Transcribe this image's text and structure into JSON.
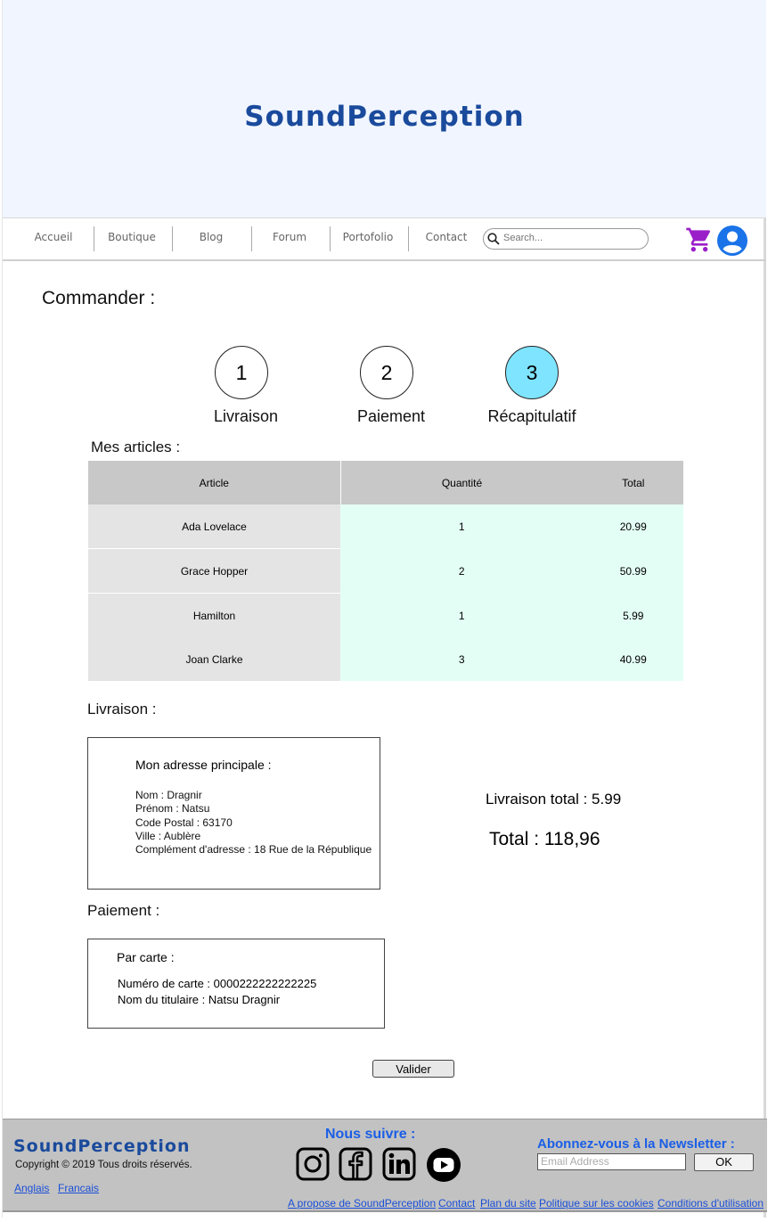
{
  "brand": "SoundPerception",
  "nav": {
    "items": [
      "Accueil",
      "Boutique",
      "Blog",
      "Forum",
      "Portofolio",
      "Contact"
    ],
    "search_placeholder": "Search..."
  },
  "colors": {
    "brand_blue": "#1a4a9c",
    "hero_bg": "#f0f5ff",
    "cart_purple": "#9b1fc9",
    "user_blue": "#1a73e8",
    "active_step": "#7fe4ff"
  },
  "page_title": "Commander :",
  "steps": [
    {
      "number": "1",
      "label": "Livraison",
      "active": false
    },
    {
      "number": "2",
      "label": "Paiement",
      "active": false
    },
    {
      "number": "3",
      "label": "Récapitulatif",
      "active": true
    }
  ],
  "articles": {
    "title": "Mes articles :",
    "columns": [
      "Article",
      "Quantité",
      "Total"
    ],
    "rows": [
      [
        "Ada Lovelace",
        "1",
        "20.99"
      ],
      [
        "Grace Hopper",
        "2",
        "50.99"
      ],
      [
        "Hamilton",
        "1",
        "5.99"
      ],
      [
        "Joan Clarke",
        "3",
        "40.99"
      ]
    ]
  },
  "livraison": {
    "title": "Livraison :",
    "box_title": "Mon adresse principale :",
    "lines": [
      "Nom : Dragnir",
      "Prénom : Natsu",
      "Code Postal : 63170",
      "Ville : Aublère",
      "Complément d'adresse : 18 Rue de la République"
    ],
    "shipping_total": "Livraison total : 5.99",
    "grand_total": "Total : 118,96"
  },
  "paiement": {
    "title": "Paiement :",
    "box_title": "Par carte :",
    "lines": [
      "Numéro de carte : 0000222222222225",
      "Nom du titulaire : Natsu Dragnir"
    ]
  },
  "valider_label": "Valider",
  "footer": {
    "brand": "SoundPerception",
    "copyright": "Copyright © 2019 Tous droits réservés.",
    "languages": [
      "Anglais",
      "Francais"
    ],
    "follow_title": "Nous suivre :",
    "social_icons": [
      "instagram-icon",
      "facebook-icon",
      "linkedin-icon",
      "youtube-icon"
    ],
    "newsletter_title": "Abonnez-vous à la Newsletter :",
    "email_placeholder": "Email Address",
    "ok_label": "OK",
    "links": [
      "A propose de SoundPerception",
      "Contact",
      "Plan du site",
      "Politique sur les cookies",
      "Conditions d'utilisation"
    ]
  }
}
